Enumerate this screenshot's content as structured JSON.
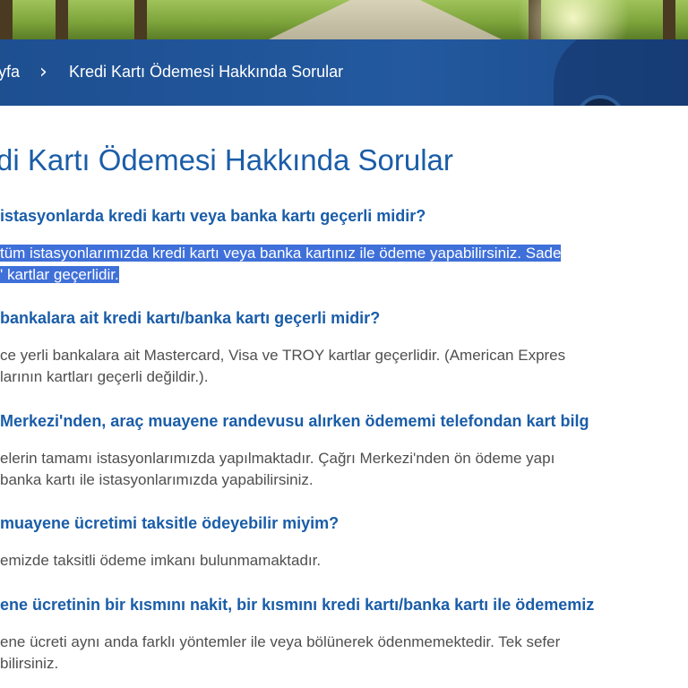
{
  "breadcrumb": {
    "home": "yfa",
    "separator": "›",
    "current": "Kredi Kartı Ödemesi Hakkında Sorular"
  },
  "page": {
    "title": "di Kartı Ödemesi Hakkında Sorular"
  },
  "faqs": [
    {
      "question": "istasyonlarda kredi kartı veya banka kartı geçerli midir?",
      "answer_lines": [
        "tüm istasyonlarımızda kredi kartı veya banka kartınız ile ödeme yapabilirsiniz. Sade",
        "' kartlar geçerlidir."
      ]
    },
    {
      "question": "bankalara ait kredi kartı/banka kartı geçerli midir?",
      "answer_lines": [
        "ce yerli bankalara ait Mastercard, Visa ve TROY kartlar geçerlidir. (American Expres",
        "larının kartları geçerli değildir.)."
      ]
    },
    {
      "question": "Merkezi'nden, araç muayene randevusu alırken ödememi telefondan kart bilg",
      "answer_lines": [
        "elerin tamamı istasyonlarımızda yapılmaktadır. Çağrı Merkezi'nden ön ödeme yapı",
        "banka kartı ile istasyonlarımızda yapabilirsiniz."
      ]
    },
    {
      "question": "muayene ücretimi taksitle ödeyebilir miyim?",
      "answer_lines": [
        "emizde taksitli ödeme imkanı bulunmamaktadır."
      ]
    },
    {
      "question": "ene ücretinin bir kısmını nakit, bir kısmını kredi kartı/banka kartı ile ödememiz",
      "answer_lines": [
        "ene ücreti aynı anda farklı yöntemler ile veya bölünerek ödenmemektedir. Tek sefer",
        "bilirsiniz."
      ]
    }
  ],
  "colors": {
    "title_blue": "#1a5da8",
    "breadcrumb_bar": "#1d4f91",
    "selection_highlight": "#3f70d9",
    "answer_text": "#4f4f4f"
  }
}
